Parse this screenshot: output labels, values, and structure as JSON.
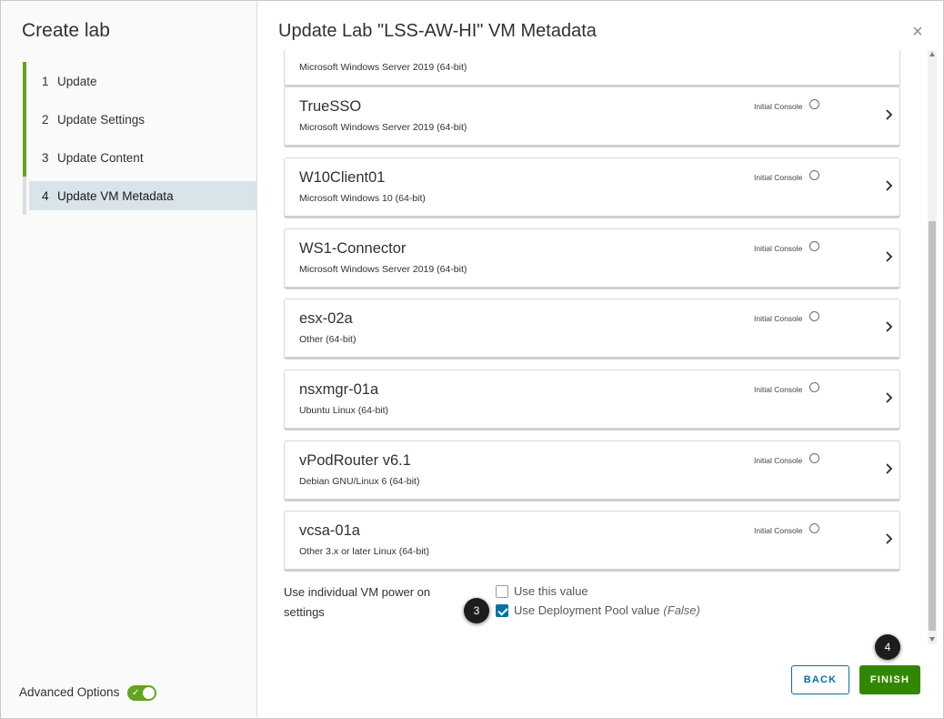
{
  "wizard": {
    "title": "Create lab",
    "steps": [
      {
        "num": "1",
        "label": "Update"
      },
      {
        "num": "2",
        "label": "Update Settings"
      },
      {
        "num": "3",
        "label": "Update Content"
      },
      {
        "num": "4",
        "label": "Update VM Metadata"
      }
    ],
    "advanced_options_label": "Advanced Options",
    "advanced_options_on": true
  },
  "main": {
    "title": "Update Lab \"LSS-AW-HI\" VM Metadata",
    "close_icon": "close-icon",
    "partial_vm": {
      "os": "Microsoft Windows Server 2019 (64-bit)"
    },
    "vms": [
      {
        "name": "TrueSSO",
        "os": "Microsoft Windows Server 2019 (64-bit)",
        "initial_console_label": "Initial Console"
      },
      {
        "name": "W10Client01",
        "os": "Microsoft Windows 10 (64-bit)",
        "initial_console_label": "Initial Console"
      },
      {
        "name": "WS1-Connector",
        "os": "Microsoft Windows Server 2019 (64-bit)",
        "initial_console_label": "Initial Console"
      },
      {
        "name": "esx-02a",
        "os": "Other (64-bit)",
        "initial_console_label": "Initial Console"
      },
      {
        "name": "nsxmgr-01a",
        "os": "Ubuntu Linux (64-bit)",
        "initial_console_label": "Initial Console"
      },
      {
        "name": "vPodRouter v6.1",
        "os": "Debian GNU/Linux 6 (64-bit)",
        "initial_console_label": "Initial Console"
      },
      {
        "name": "vcsa-01a",
        "os": "Other 3.x or later Linux (64-bit)",
        "initial_console_label": "Initial Console"
      }
    ],
    "power_on": {
      "label_line1": "Use individual VM power on",
      "label_line2": "settings",
      "option_this_value": "Use this value",
      "option_this_value_checked": false,
      "option_pool_value": "Use Deployment Pool value",
      "option_pool_value_suffix": "(False)",
      "option_pool_value_checked": true
    }
  },
  "callouts": {
    "step3": "3",
    "step4": "4"
  },
  "buttons": {
    "back": "BACK",
    "finish": "FINISH"
  },
  "colors": {
    "accent_green": "#62a420",
    "finish_green": "#318700",
    "link_blue": "#0072a3",
    "active_step_bg": "#d9e4ea"
  }
}
